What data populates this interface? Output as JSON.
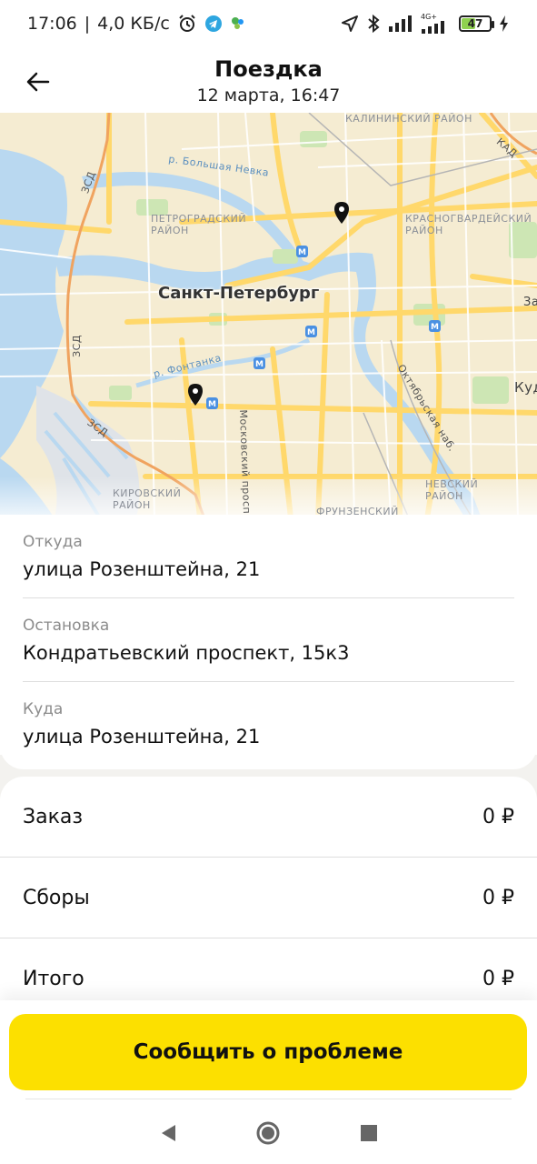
{
  "status_bar": {
    "time": "17:06",
    "separator": "|",
    "speed": "4,0 КБ/с",
    "battery": "47",
    "network": "4G+"
  },
  "header": {
    "title": "Поездка",
    "subtitle": "12 марта, 16:47"
  },
  "map": {
    "city": "Санкт-Петербург",
    "labels": {
      "kalininsky": "КАЛИНИНСКИЙ РАЙОН",
      "petrogradsky": "ПЕТРОГРАДСКИЙ РАЙОН",
      "krasnogvardeysky": "КРАСНОГВАРДЕЙСКИЙ РАЙОН",
      "nevsky": "НЕВСКИЙ РАЙОН",
      "kirovsky": "КИРОВСКИЙ РАЙОН",
      "frunzensky": "ФРУНЗЕНСКИЙ",
      "bolshaya_nevka": "р. Большая Невка",
      "fontanka": "р. Фонтанка",
      "moskovsky": "Московский просп.",
      "oktyabrskaya": "Октябрьская наб.",
      "zsd1": "ЗСД",
      "zsd2": "ЗСД",
      "zsd3": "ЗСД",
      "kad": "КАД",
      "kud": "Куд",
      "za": "За"
    }
  },
  "addresses": [
    {
      "label": "Откуда",
      "value": "улица Розенштейна, 21"
    },
    {
      "label": "Остановка",
      "value": "Кондратьевский проспект, 15к3"
    },
    {
      "label": "Куда",
      "value": "улица Розенштейна, 21"
    }
  ],
  "prices": [
    {
      "label": "Заказ",
      "value": "0 ₽"
    },
    {
      "label": "Сборы",
      "value": "0 ₽"
    },
    {
      "label": "Итого",
      "value": "0 ₽"
    }
  ],
  "actions": {
    "report_label": "Сообщить о проблеме"
  },
  "colors": {
    "accent_yellow": "#fce000",
    "map_land": "#f5ecd2",
    "map_water": "#b9d8f0",
    "road": "#ffd86b",
    "secondary_text": "#8c8c8c"
  },
  "icons": {
    "back": "arrow-left-icon",
    "pin": "map-pin-icon",
    "metro": "metro-station-icon",
    "nav_back": "triangle-back-icon",
    "nav_home": "circle-home-icon",
    "nav_recents": "square-recents-icon"
  }
}
